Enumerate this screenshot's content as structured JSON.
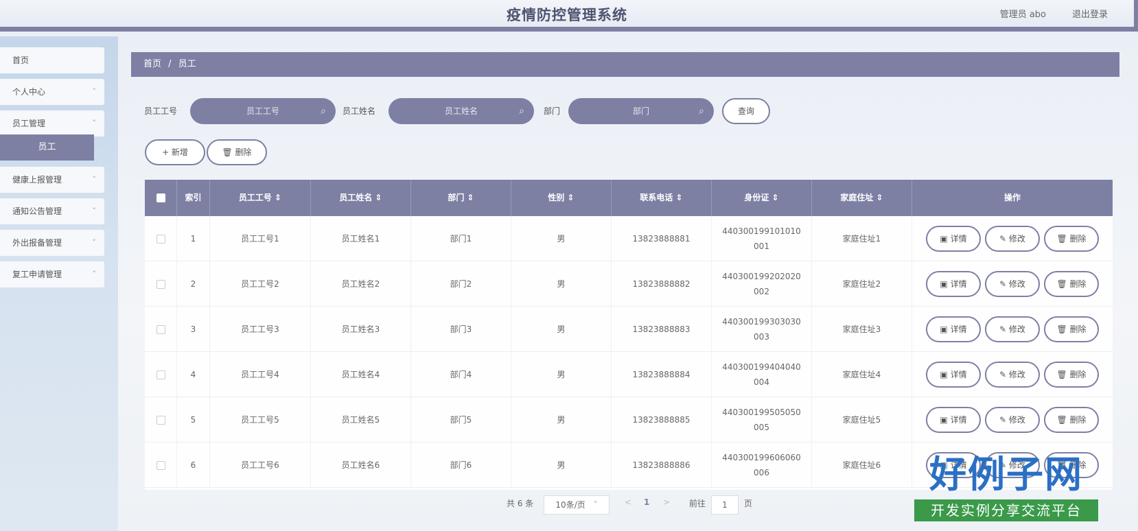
{
  "header": {
    "title": "疫情防控管理系统",
    "user": "管理员 abo",
    "logout": "退出登录"
  },
  "sidebar": {
    "items": [
      {
        "label": "首页",
        "chevron": ""
      },
      {
        "label": "个人中心",
        "chevron": "˅"
      },
      {
        "label": "员工管理",
        "chevron": "˅"
      },
      {
        "label": "健康上报管理",
        "chevron": "˅"
      },
      {
        "label": "通知公告管理",
        "chevron": "˅"
      },
      {
        "label": "外出报备管理",
        "chevron": "˅"
      },
      {
        "label": "复工申请管理",
        "chevron": "˅"
      }
    ],
    "active_sub": "员工"
  },
  "breadcrumb": {
    "home": "首页",
    "sep": "/",
    "current": "员工"
  },
  "search": {
    "emp_no_label": "员工工号",
    "emp_no_placeholder": "员工工号",
    "emp_name_label": "员工姓名",
    "emp_name_placeholder": "员工姓名",
    "dept_label": "部门",
    "dept_placeholder": "部门",
    "query_button": "查询"
  },
  "toolbar": {
    "add": "+ 新增",
    "delete": "🗑 删除"
  },
  "table": {
    "headers": [
      "索引",
      "员工工号 ⇕",
      "员工姓名 ⇕",
      "部门 ⇕",
      "性别 ⇕",
      "联系电话 ⇕",
      "身份证 ⇕",
      "家庭住址 ⇕",
      "操作"
    ],
    "rows": [
      {
        "idx": "1",
        "no": "员工工号1",
        "name": "员工姓名1",
        "dept": "部门1",
        "sex": "男",
        "phone": "13823888881",
        "id": "440300199101010001",
        "addr": "家庭住址1"
      },
      {
        "idx": "2",
        "no": "员工工号2",
        "name": "员工姓名2",
        "dept": "部门2",
        "sex": "男",
        "phone": "13823888882",
        "id": "440300199202020002",
        "addr": "家庭住址2"
      },
      {
        "idx": "3",
        "no": "员工工号3",
        "name": "员工姓名3",
        "dept": "部门3",
        "sex": "男",
        "phone": "13823888883",
        "id": "440300199303030003",
        "addr": "家庭住址3"
      },
      {
        "idx": "4",
        "no": "员工工号4",
        "name": "员工姓名4",
        "dept": "部门4",
        "sex": "男",
        "phone": "13823888884",
        "id": "440300199404040004",
        "addr": "家庭住址4"
      },
      {
        "idx": "5",
        "no": "员工工号5",
        "name": "员工姓名5",
        "dept": "部门5",
        "sex": "男",
        "phone": "13823888885",
        "id": "440300199505050005",
        "addr": "家庭住址5"
      },
      {
        "idx": "6",
        "no": "员工工号6",
        "name": "员工姓名6",
        "dept": "部门6",
        "sex": "男",
        "phone": "13823888886",
        "id": "440300199606060006",
        "addr": "家庭住址6"
      }
    ],
    "actions": {
      "detail": "▣ 详情",
      "edit": "✎ 修改",
      "delete": "🗑 删除"
    }
  },
  "pagination": {
    "total": "共 6 条",
    "page_size": "10条/页",
    "prev": "<",
    "current": "1",
    "next": ">",
    "goto": "前往",
    "goto_value": "1",
    "page_unit": "页"
  },
  "badge": {
    "big": "好例子网",
    "small": "开发实例分享交流平台"
  },
  "colors": {
    "accent": "#7d7fa3",
    "badge_blue": "#2a6fc4",
    "badge_green": "#3a9a4a"
  }
}
